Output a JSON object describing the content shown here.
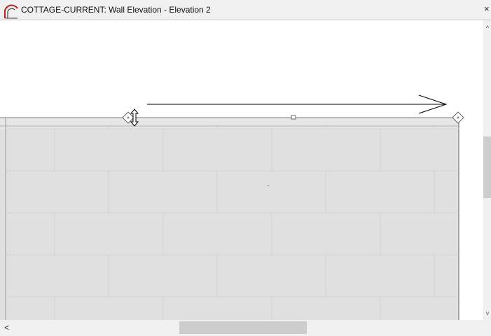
{
  "window": {
    "title": "COTTAGE-CURRENT: Wall Elevation - Elevation 2",
    "close_label": "×"
  },
  "scrollbars": {
    "up_glyph": "^",
    "down_glyph": "˅",
    "left_glyph": "<"
  },
  "colors": {
    "wall_fill": "#e0e0e0",
    "brick_joint": "#d2d2d2",
    "outline": "#7a7a7a",
    "dimension_line": "#000000",
    "handle_fill": "#ffffff"
  },
  "icons": {
    "app_icon": "chief-architect-logo-icon",
    "endpoint_handle": "diamond-handle-icon",
    "resize_cursor": "vertical-resize-cursor-icon",
    "midpoint_handle": "square-handle-icon",
    "arrowhead": "open-arrow-icon"
  }
}
